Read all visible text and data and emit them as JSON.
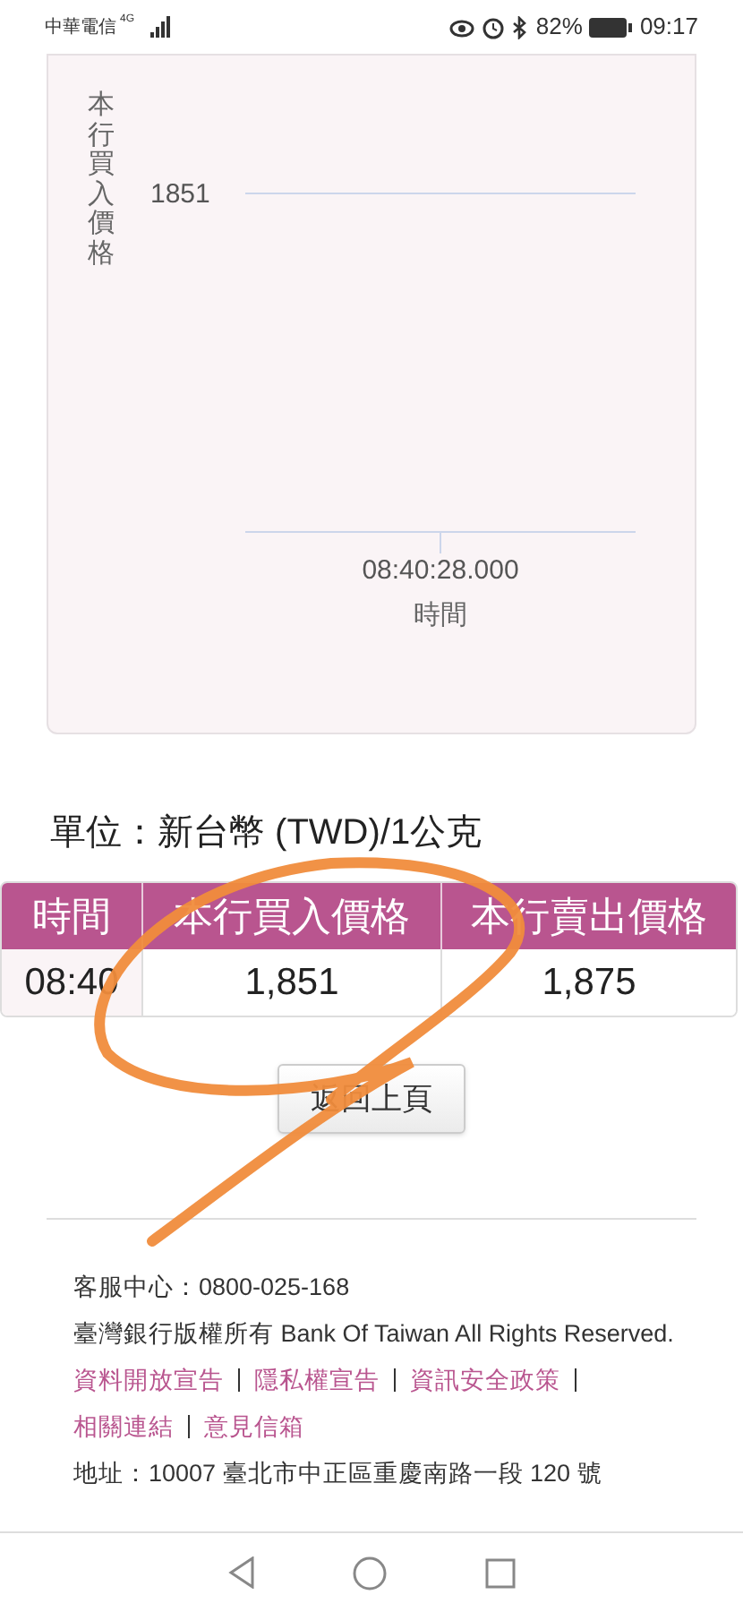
{
  "status_bar": {
    "carrier": "中華電信",
    "network": "4G",
    "battery": "82%",
    "time": "09:17"
  },
  "chart": {
    "y_axis_title": "本行買入價格",
    "y_tick": "1851",
    "x_tick": "08:40:28.000",
    "x_axis_title": "時間"
  },
  "unit": "單位：新台幣 (TWD)/1公克",
  "table": {
    "columns": [
      "時間",
      "本行買入價格",
      "本行賣出價格"
    ],
    "rows": [
      [
        "08:40",
        "1,851",
        "1,875"
      ]
    ]
  },
  "back_button": "返回上頁",
  "footer": {
    "service": "客服中心：0800-025-168",
    "copyright": "臺灣銀行版權所有 Bank Of Taiwan All Rights Reserved.",
    "links": [
      "資料開放宣告",
      "隱私權宣告",
      "資訊安全政策",
      "相關連結",
      "意見信箱"
    ],
    "address": "地址：10007 臺北市中正區重慶南路一段 120 號"
  }
}
